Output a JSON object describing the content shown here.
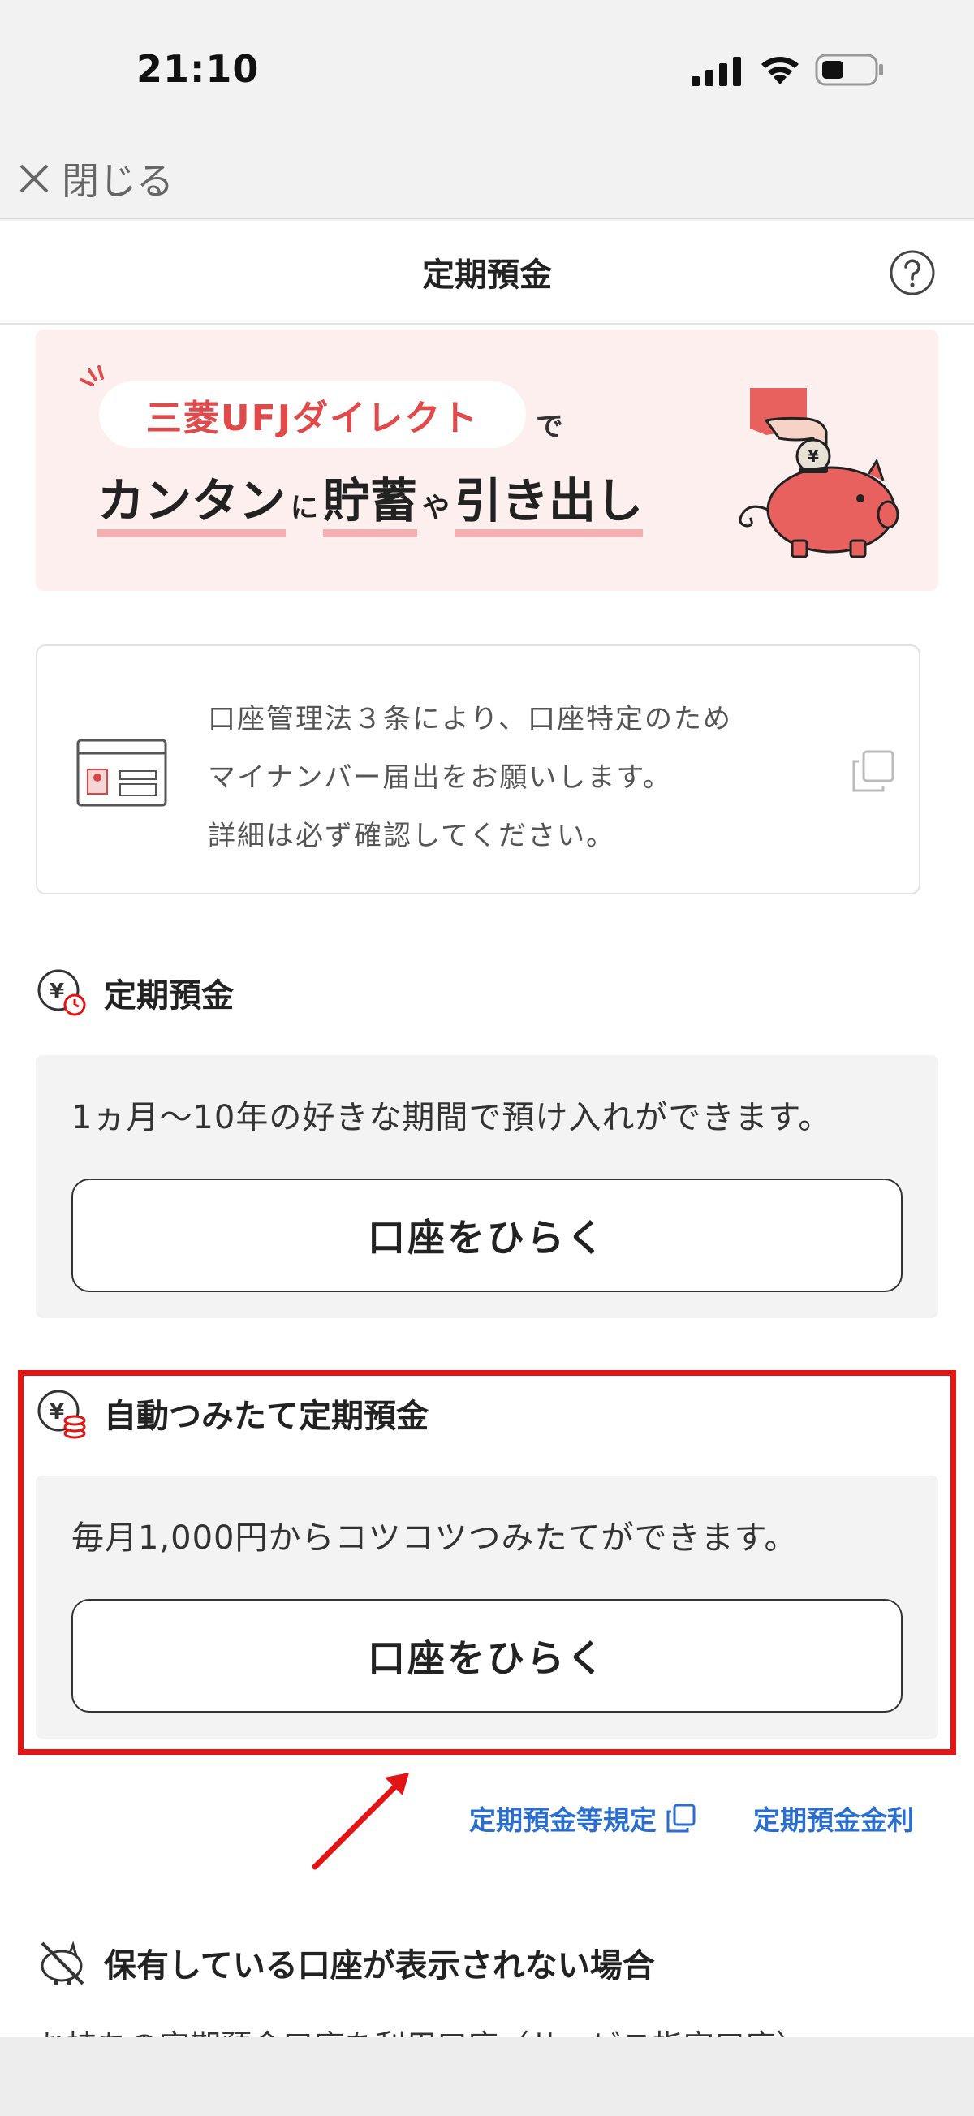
{
  "status_bar": {
    "time": "21:10"
  },
  "close_bar": {
    "label": "閉じる"
  },
  "header": {
    "title": "定期預金"
  },
  "banner": {
    "pill_text": "三菱UFJダイレクト",
    "de": "で",
    "line2": [
      {
        "text": "カンタン",
        "size": "big"
      },
      {
        "text": "に",
        "size": "small"
      },
      {
        "text": "貯蓄",
        "size": "big"
      },
      {
        "text": "や",
        "size": "small"
      },
      {
        "text": "引き出し",
        "size": "big"
      }
    ]
  },
  "notice": {
    "line1": "口座管理法３条により、口座特定のため",
    "line2": "マイナンバー届出をお願いします。",
    "line3": "詳細は必ず確認してください。"
  },
  "sections": {
    "fixed": {
      "title": "定期預金",
      "description": "1ヵ月〜10年の好きな期間で預け入れができます。",
      "button": "口座をひらく"
    },
    "auto": {
      "title": "自動つみたて定期預金",
      "description": "毎月1,000円からコツコツつみたてができます。",
      "button": "口座をひらく"
    }
  },
  "links": {
    "rules": "定期預金等規定",
    "rates": "定期預金金利"
  },
  "missing": {
    "title": "保有している口座が表示されない場合",
    "body": "お持ちの定期預金口座を利用口座（サービス指定口座）"
  },
  "colors": {
    "accent_red": "#e31414",
    "link_blue": "#2a6fd0",
    "banner_bg": "#fcefee"
  }
}
